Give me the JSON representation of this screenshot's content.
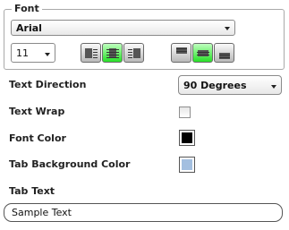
{
  "font_group": {
    "legend": "Font",
    "family": "Arial",
    "size": "11",
    "h_align_buttons": [
      {
        "name": "align-left-icon",
        "active": false
      },
      {
        "name": "align-center-icon",
        "active": true
      },
      {
        "name": "align-right-icon",
        "active": false
      }
    ],
    "v_align_buttons": [
      {
        "name": "align-top-icon",
        "active": false
      },
      {
        "name": "align-middle-icon",
        "active": true
      },
      {
        "name": "align-bottom-icon",
        "active": false
      }
    ]
  },
  "text_direction": {
    "label": "Text Direction",
    "value": "90 Degrees"
  },
  "text_wrap": {
    "label": "Text Wrap",
    "checked": false
  },
  "font_color": {
    "label": "Font Color",
    "color": "#000000"
  },
  "tab_background_color": {
    "label": "Tab Background Color",
    "color": "#a3bfe0"
  },
  "tab_text": {
    "label": "Tab Text",
    "value": "Sample Text"
  },
  "colors": {
    "active_button": "#33dd33",
    "group_border": "#a9a9a9"
  }
}
